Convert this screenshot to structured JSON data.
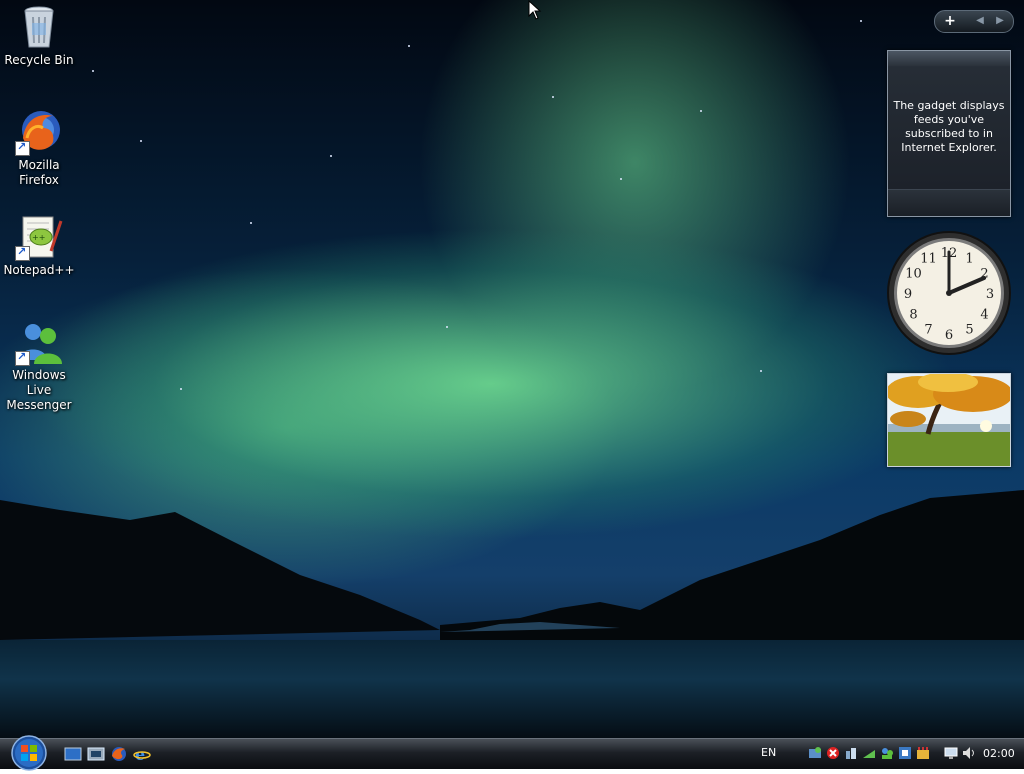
{
  "desktop": {
    "icons": [
      {
        "label": "Recycle Bin",
        "icon": "recycle-bin-icon"
      },
      {
        "label": "Mozilla\nFirefox",
        "icon": "firefox-icon"
      },
      {
        "label": "Notepad++",
        "icon": "notepad-plus-plus-icon"
      },
      {
        "label": "Windows Live\nMessenger",
        "icon": "windows-live-messenger-icon"
      }
    ]
  },
  "sidebar": {
    "controls": {
      "add": "+",
      "prev": "◀",
      "next": "▶"
    },
    "feed_gadget": {
      "message": "The gadget displays feeds you've subscribed to in Internet Explorer."
    },
    "clock_gadget": {
      "time": "02:00",
      "numbers": [
        "12",
        "1",
        "2",
        "3",
        "4",
        "5",
        "6",
        "7",
        "8",
        "9",
        "10",
        "11"
      ]
    },
    "slideshow_gadget": {
      "icon": "autumn-tree-photo"
    }
  },
  "taskbar": {
    "quick_launch": [
      "show-desktop-icon",
      "switch-windows-icon",
      "firefox-icon",
      "internet-explorer-icon"
    ],
    "language": "EN",
    "tray_icons": [
      "network-status-icon",
      "security-alert-icon",
      "shield-icon",
      "network-icon",
      "messenger-tray-icon",
      "tool-icon",
      "update-icon",
      "display-icon",
      "volume-icon"
    ],
    "clock": "02:00"
  },
  "colors": {
    "accent": "#2f6fc2",
    "aurora": "#6fe39a",
    "taskbar": "#1c2026"
  }
}
